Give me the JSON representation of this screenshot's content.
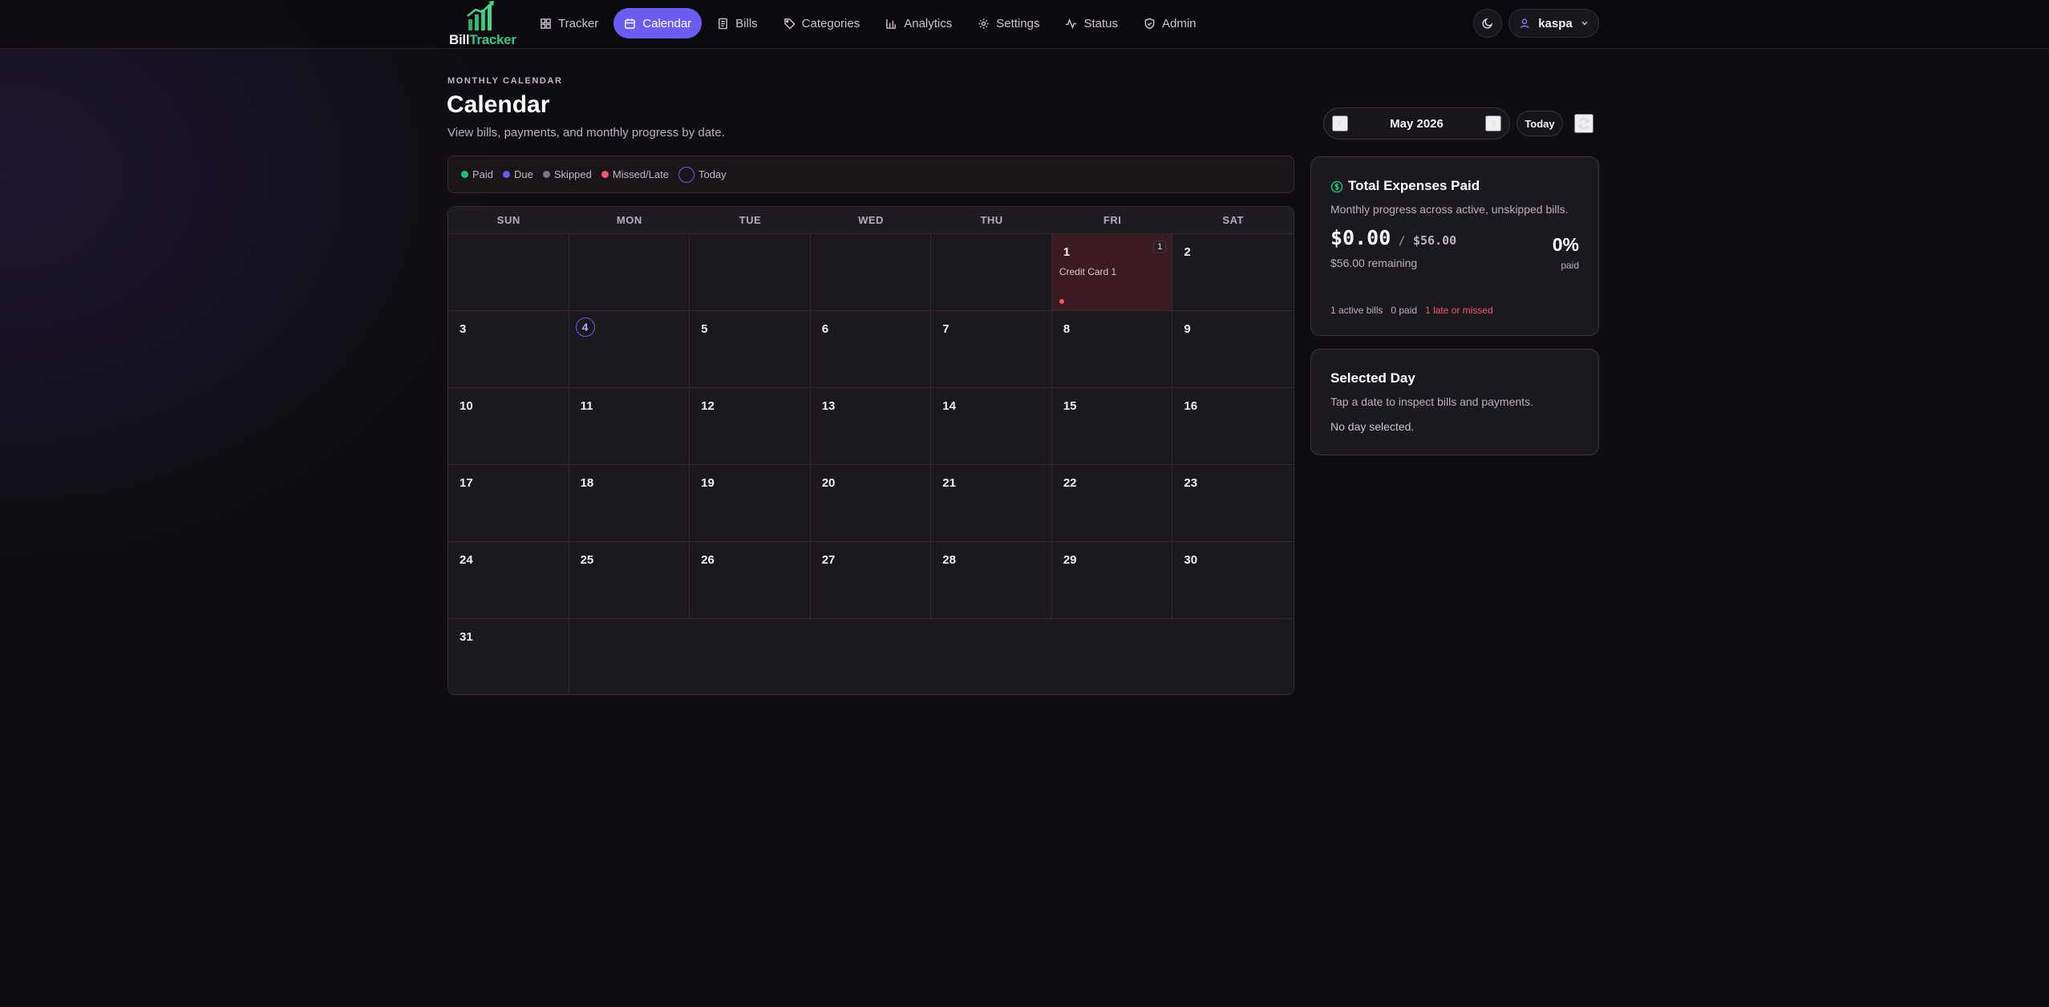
{
  "app": {
    "logo_word_1": "Bill",
    "logo_word_2": "Tracker"
  },
  "nav": {
    "items": [
      {
        "label": "Tracker",
        "icon": "grid-icon"
      },
      {
        "label": "Calendar",
        "icon": "calendar-icon",
        "active": true
      },
      {
        "label": "Bills",
        "icon": "document-icon"
      },
      {
        "label": "Categories",
        "icon": "tag-icon"
      },
      {
        "label": "Analytics",
        "icon": "bar-chart-icon"
      },
      {
        "label": "Settings",
        "icon": "gear-icon"
      },
      {
        "label": "Status",
        "icon": "activity-icon"
      },
      {
        "label": "Admin",
        "icon": "shield-icon"
      }
    ]
  },
  "user": {
    "name": "kaspa"
  },
  "header": {
    "eyebrow": "MONTHLY CALENDAR",
    "title": "Calendar",
    "subtitle": "View bills, payments, and monthly progress by date."
  },
  "legend": [
    {
      "label": "Paid",
      "color": "#1fbf7a"
    },
    {
      "label": "Due",
      "color": "#6b5cf2"
    },
    {
      "label": "Skipped",
      "color": "#7a7580"
    },
    {
      "label": "Missed/Late",
      "color": "#f0596b"
    },
    {
      "label": "Today",
      "color": "#6b5cf2"
    }
  ],
  "month_nav": {
    "label": "May 2026",
    "today_label": "Today"
  },
  "calendar": {
    "weekdays": [
      "SUN",
      "MON",
      "TUE",
      "WED",
      "THU",
      "FRI",
      "SAT"
    ],
    "days": [
      {
        "day": "1",
        "status": "missed",
        "count": "1",
        "bill": "Credit Card 1"
      },
      {
        "day": "2"
      },
      {
        "day": "3"
      },
      {
        "day": "4",
        "today": true
      },
      {
        "day": "5"
      },
      {
        "day": "6"
      },
      {
        "day": "7"
      },
      {
        "day": "8"
      },
      {
        "day": "9"
      },
      {
        "day": "10"
      },
      {
        "day": "11"
      },
      {
        "day": "12"
      },
      {
        "day": "13"
      },
      {
        "day": "14"
      },
      {
        "day": "15"
      },
      {
        "day": "16"
      },
      {
        "day": "17"
      },
      {
        "day": "18"
      },
      {
        "day": "19"
      },
      {
        "day": "20"
      },
      {
        "day": "21"
      },
      {
        "day": "22"
      },
      {
        "day": "23"
      },
      {
        "day": "24"
      },
      {
        "day": "25"
      },
      {
        "day": "26"
      },
      {
        "day": "27"
      },
      {
        "day": "28"
      },
      {
        "day": "29"
      },
      {
        "day": "30"
      },
      {
        "day": "31"
      }
    ]
  },
  "expenses": {
    "title": "Total Expenses Paid",
    "subtitle": "Monthly progress across active, unskipped bills.",
    "paid": "$0.00",
    "separator": "/",
    "total": "$56.00",
    "remaining": "$56.00 remaining",
    "percent": "0%",
    "percent_label": "paid",
    "progress_fraction": 0,
    "active_bills": "1 active bills",
    "paid_count": "0 paid",
    "late": "1 late or missed"
  },
  "selected_day": {
    "title": "Selected Day",
    "subtitle": "Tap a date to inspect bills and payments.",
    "empty": "No day selected."
  }
}
